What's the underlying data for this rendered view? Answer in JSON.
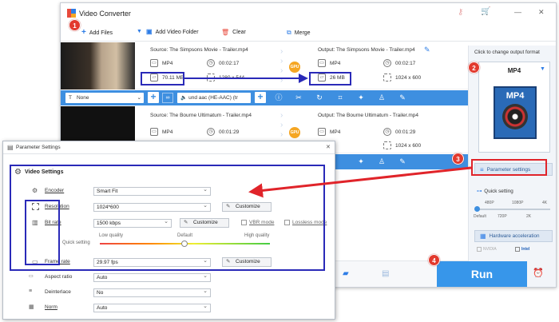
{
  "window": {
    "title": "Video Converter",
    "controls": {
      "min": "—",
      "close": "✕"
    }
  },
  "toolbar": {
    "add_files": "Add Files",
    "add_video_folder": "Add Video Folder",
    "clear": "Clear",
    "merge": "Merge"
  },
  "tasks": [
    {
      "source": "Source: The Simpsons Movie - Trailer.mp4",
      "src_format": "MP4",
      "src_duration": "00:02:17",
      "src_size": "70.11 MB",
      "src_resolution": "1280 x 544",
      "output": "Output: The Simpsons Movie - Trailer.mp4",
      "out_format": "MP4",
      "out_duration": "00:02:17",
      "out_size": "26 MB",
      "out_resolution": "1024 x 600",
      "gpu": "GPU"
    },
    {
      "source": "Source: The Bourne Ultimatum - Trailer.mp4",
      "src_format": "MP4",
      "src_duration": "00:01:29",
      "output": "Output: The Bourne Ultimatum - Trailer.mp4",
      "out_format": "MP4",
      "out_duration": "00:01:29",
      "out_resolution": "1024 x 600",
      "gpu": "GPU"
    }
  ],
  "editbar": {
    "subtitle": "None",
    "audio": "und aac (HE-AAC) (tr"
  },
  "right_panel": {
    "hint": "Click to change output format",
    "format": "MP4",
    "format_icon_text": "MP4",
    "parameter_settings": "Parameter settings",
    "quick_setting": "Quick setting",
    "slider_top": [
      "480P",
      "1080P",
      "4K"
    ],
    "slider_bottom": [
      "Default",
      "720P",
      "2K"
    ],
    "hardware_acceleration": "Hardware acceleration",
    "nvidia": "NVIDIA",
    "intel": "Intel",
    "run": "Run"
  },
  "dialog": {
    "title": "Parameter Settings",
    "section": "Video Settings",
    "encoder_label": "Encoder",
    "encoder_value": "Smart Fit",
    "resolution_label": "Resolution",
    "resolution_value": "1024*600",
    "bitrate_label": "Bit rate",
    "bitrate_value": "1500 kbps",
    "customize": "Customize",
    "vbr_mode": "VBR mode",
    "lossless_mode": "Lossless mode",
    "quick_setting": "Quick setting",
    "low_quality": "Low quality",
    "default": "Default",
    "high_quality": "High quality",
    "framerate_label": "Frame rate",
    "framerate_value": "29.97 fps",
    "aspect_label": "Aspect ratio",
    "aspect_value": "Auto",
    "deinterlace_label": "Deinterlace",
    "deinterlace_value": "No",
    "norm_label": "Norm",
    "norm_value": "Auto"
  },
  "badges": [
    "1",
    "2",
    "3",
    "4"
  ],
  "colors": {
    "accent_blue": "#3e8fe0",
    "run_blue": "#3796ea",
    "annotation_red": "#e23a2e",
    "annotation_blue": "#2a2ab8"
  }
}
